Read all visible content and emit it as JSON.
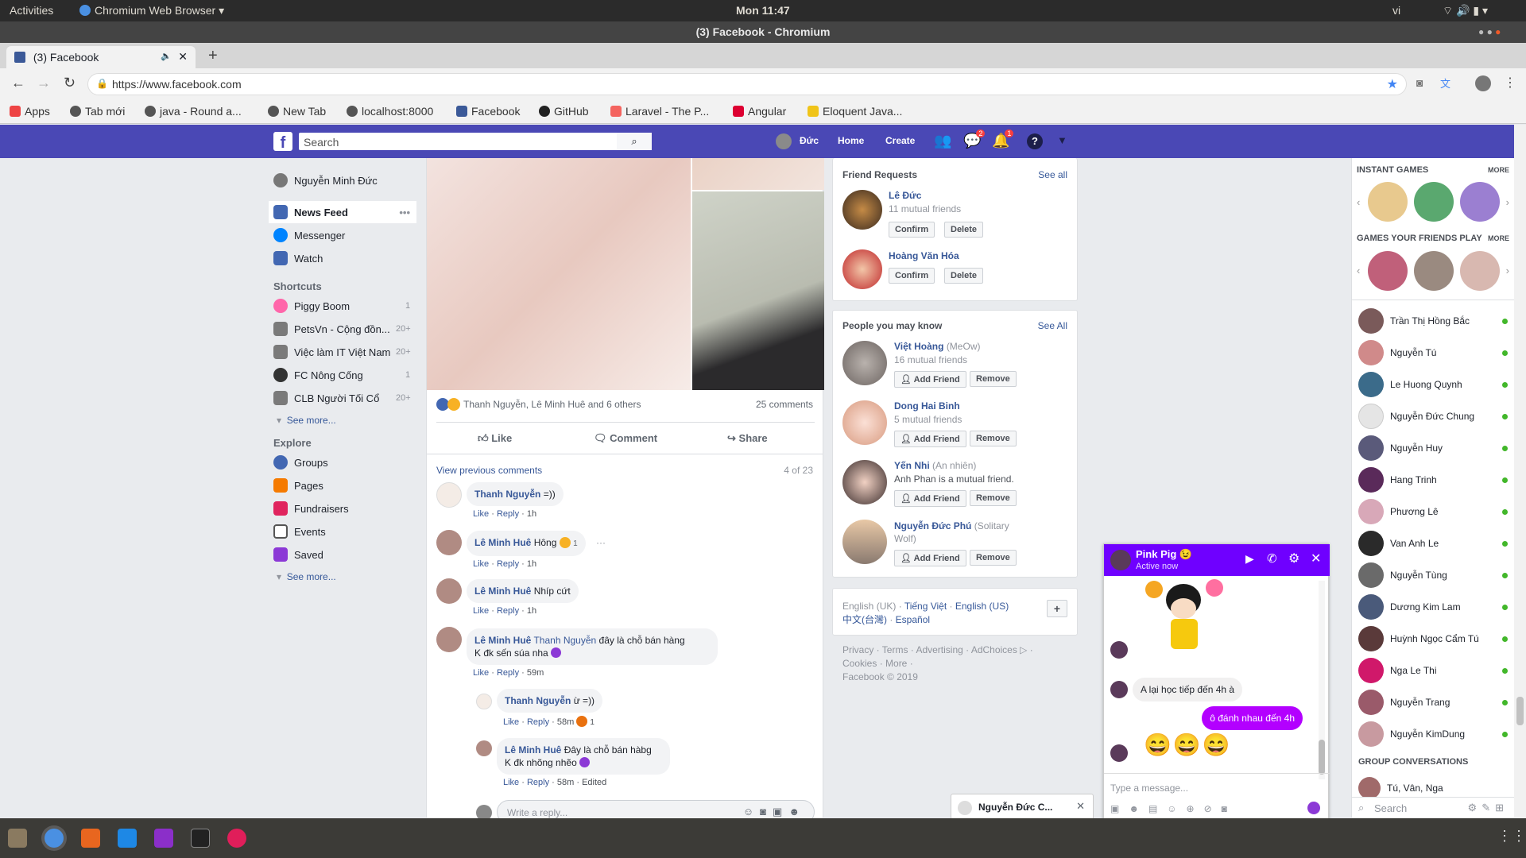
{
  "os": {
    "activities": "Activities",
    "app": "Chromium Web Browser",
    "clock": "Mon 11:47",
    "lang": "vi"
  },
  "window": {
    "title": "(3) Facebook - Chromium"
  },
  "tab": {
    "title": "(3) Facebook"
  },
  "address": {
    "url": "https://www.facebook.com"
  },
  "bookmarks": [
    {
      "label": "Apps",
      "color": "#e44"
    },
    {
      "label": "Tab mới",
      "color": "#555"
    },
    {
      "label": "java - Round a...",
      "color": "#555"
    },
    {
      "label": "New Tab",
      "color": "#555"
    },
    {
      "label": "localhost:8000",
      "color": "#555"
    },
    {
      "label": "Facebook",
      "color": "#3b5998"
    },
    {
      "label": "GitHub",
      "color": "#222"
    },
    {
      "label": "Laravel - The P...",
      "color": "#f4645f"
    },
    {
      "label": "Angular",
      "color": "#dd0031"
    },
    {
      "label": "Eloquent Java...",
      "color": "#f0c419"
    }
  ],
  "fb": {
    "search_placeholder": "Search",
    "user": "Đức",
    "home": "Home",
    "create": "Create",
    "messages_badge": "2",
    "notif_badge": "1",
    "accent": "#4a48b5"
  },
  "left": {
    "profile": "Nguyễn Minh Đức",
    "newsfeed": "News Feed",
    "messenger": "Messenger",
    "watch": "Watch",
    "shortcuts_title": "Shortcuts",
    "shortcuts": [
      {
        "label": "Piggy Boom",
        "count": "1"
      },
      {
        "label": "PetsVn - Cộng đồn...",
        "count": "20+"
      },
      {
        "label": "Việc làm IT Việt Nam",
        "count": "20+"
      },
      {
        "label": "FC Nông Cống",
        "count": "1"
      },
      {
        "label": "CLB Người Tối Cổ",
        "count": "20+"
      }
    ],
    "see_more": "See more...",
    "explore_title": "Explore",
    "explore": [
      "Groups",
      "Pages",
      "Fundraisers",
      "Events",
      "Saved"
    ],
    "see_more2": "See more..."
  },
  "post": {
    "reactions": "Thanh Nguyễn, Lê Minh Huê and 6 others",
    "comments_count": "25 comments",
    "like": "Like",
    "comment": "Comment",
    "share": "Share",
    "view_prev": "View previous comments",
    "paging": "4 of 23",
    "comments": [
      {
        "name": "Thanh Nguyễn",
        "text": "=))",
        "meta_like": "Like",
        "meta_reply": "Reply",
        "time": "1h"
      },
      {
        "name": "Lê Minh Huê",
        "text": "Hông",
        "react": "1",
        "meta_like": "Like",
        "meta_reply": "Reply",
        "time": "1h"
      },
      {
        "name": "Lê Minh Huê",
        "text": "Nhíp cứt",
        "meta_like": "Like",
        "meta_reply": "Reply",
        "time": "1h"
      },
      {
        "name": "Lê Minh Huê",
        "tag": "Thanh Nguyễn",
        "text": "đây là chỗ bán hàng",
        "text2": "K đk sến súa nha",
        "meta_like": "Like",
        "meta_reply": "Reply",
        "time": "59m"
      }
    ],
    "replies": [
      {
        "name": "Thanh Nguyễn",
        "text": "ừ =))",
        "react": "1",
        "meta_like": "Like",
        "meta_reply": "Reply",
        "time": "58m"
      },
      {
        "name": "Lê Minh Huê",
        "text": "Đây là chỗ bán hàbg",
        "text2": "K đk nhõng nhẽo",
        "meta_like": "Like",
        "meta_reply": "Reply",
        "time": "58m",
        "edited": "Edited"
      }
    ],
    "reply_placeholder": "Write a reply..."
  },
  "requests": {
    "title": "Friend Requests",
    "see_all": "See all",
    "items": [
      {
        "name": "Lê Đức",
        "mutual": "11 mutual friends",
        "confirm": "Confirm",
        "delete": "Delete"
      },
      {
        "name": "Hoàng Văn Hóa",
        "confirm": "Confirm",
        "delete": "Delete"
      }
    ]
  },
  "pymk": {
    "title": "People you may know",
    "see_all": "See All",
    "items": [
      {
        "name": "Việt Hoàng",
        "alias": "(MeOw)",
        "sub": "16 mutual friends",
        "add": "Add Friend",
        "remove": "Remove"
      },
      {
        "name": "Dong Hai Binh",
        "alias": "",
        "sub": "5 mutual friends",
        "add": "Add Friend",
        "remove": "Remove"
      },
      {
        "name": "Yến Nhi",
        "alias": "(An nhiên)",
        "sub": "Anh Phan is a mutual friend.",
        "add": "Add Friend",
        "remove": "Remove"
      },
      {
        "name": "Nguyễn Đức Phú",
        "alias": "(Solitary",
        "alias2": "Wolf)",
        "sub": "",
        "add": "Add Friend",
        "remove": "Remove"
      }
    ]
  },
  "langs": {
    "l1": "English (UK)",
    "l2": "Tiếng Việt",
    "l3": "English (US)",
    "l4": "中文(台灣)",
    "l5": "Español",
    "plus": "+"
  },
  "footer": {
    "line1": "Privacy · Terms · Advertising · AdChoices ▷ ·",
    "line2": "Cookies · More ·",
    "copy": "Facebook © 2019"
  },
  "chatside": {
    "games": "INSTANT GAMES",
    "more": "MORE",
    "friends_play": "GAMES YOUR FRIENDS PLAY",
    "more2": "MORE",
    "friends": [
      "Trần Thị Hồng Bắc",
      "Nguyễn Tú",
      "Le Huong Quynh",
      "Nguyễn Đức Chung",
      "Nguyễn Huy",
      "Hang Trinh",
      "Phương Lê",
      "Van Anh Le",
      "Nguyễn Tùng",
      "Dương Kim Lam",
      "Huỳnh Ngọc Cẩm Tú",
      "Nga Le Thi",
      "Nguyễn Trang",
      "Nguyễn KimDung"
    ],
    "group_title": "GROUP CONVERSATIONS",
    "group": "Tú, Vân, Nga",
    "search": "Search"
  },
  "chat": {
    "name": "Pink Pig 😉",
    "status": "Active now",
    "msg1": "A lại học tiếp đến 4h à",
    "msg2": "ô đánh nhau đến 4h",
    "emojis": "😄😄😄",
    "placeholder": "Type a message...",
    "accent": "#6f00ff"
  },
  "minichat": {
    "name": "Nguyễn Đức C..."
  }
}
